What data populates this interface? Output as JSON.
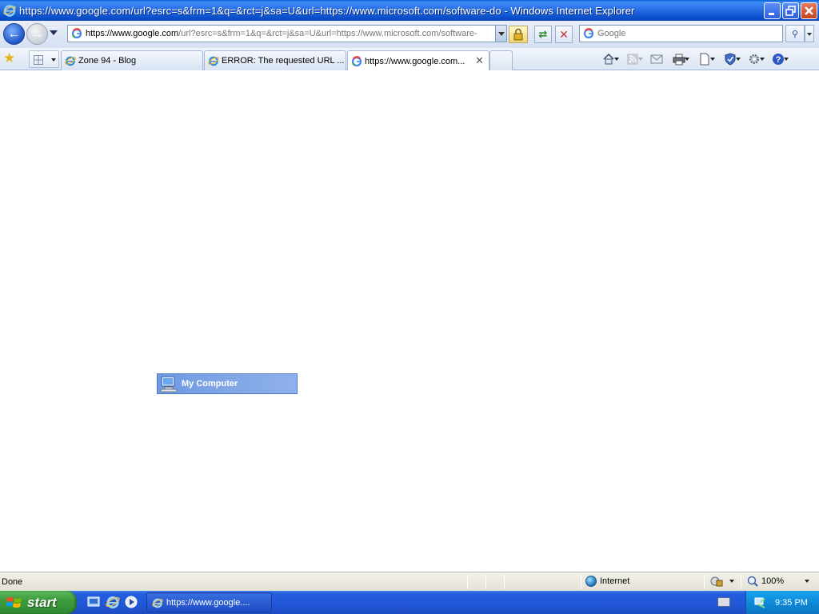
{
  "window": {
    "title": "https://www.google.com/url?esrc=s&frm=1&q=&rct=j&sa=U&url=https://www.microsoft.com/software-do - Windows Internet Explorer"
  },
  "address": {
    "url_prefix": "https://www.",
    "url_domain": "google.com",
    "url_rest": "/url?esrc=s&frm=1&q=&rct=j&sa=U&url=https://www.microsoft.com/software-"
  },
  "search": {
    "placeholder": "Google"
  },
  "tabs": [
    {
      "label": "Zone 94 - Blog"
    },
    {
      "label": "ERROR: The requested URL ..."
    },
    {
      "label": "https://www.google.com..."
    }
  ],
  "content": {
    "drag_label": "My Computer"
  },
  "status": {
    "text": "Done",
    "zone": "Internet",
    "zoom": "100%"
  },
  "taskbar": {
    "start_label": "start",
    "task_label": "https://www.google....",
    "clock": "9:35 PM"
  },
  "colors": {
    "titlebar": "#0b53cf",
    "taskbar": "#245edc",
    "start": "#3d9b3d"
  }
}
